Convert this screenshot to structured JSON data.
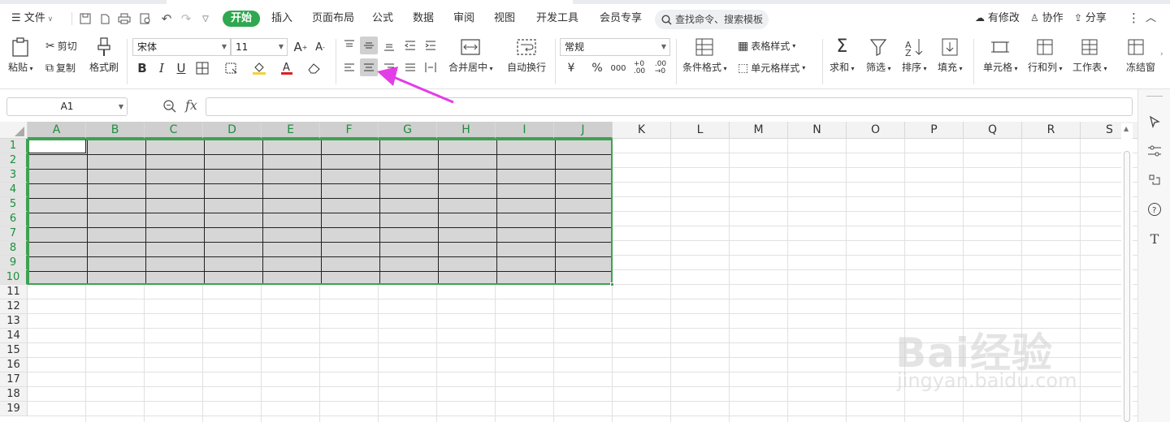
{
  "menubar": {
    "file": "文件",
    "tabs": [
      {
        "label": "开始",
        "active": true
      },
      {
        "label": "插入"
      },
      {
        "label": "页面布局"
      },
      {
        "label": "公式"
      },
      {
        "label": "数据"
      },
      {
        "label": "审阅"
      },
      {
        "label": "视图"
      },
      {
        "label": "开发工具"
      },
      {
        "label": "会员专享"
      }
    ],
    "search_placeholder": "查找命令、搜索模板",
    "right": {
      "modified": "有修改",
      "collab": "协作",
      "share": "分享"
    }
  },
  "ribbon": {
    "paste": "粘贴",
    "cut": "剪切",
    "copy": "复制",
    "format_painter": "格式刷",
    "font_name": "宋体",
    "font_size": "11",
    "merge_center": "合并居中",
    "wrap_text": "自动换行",
    "number_format": "常规",
    "cond_format": "条件格式",
    "table_style": "表格样式",
    "cell_style": "单元格样式",
    "sum": "求和",
    "filter": "筛选",
    "sort": "排序",
    "fill": "填充",
    "cell": "单元格",
    "row_col": "行和列",
    "worksheet": "工作表",
    "freeze": "冻结窗"
  },
  "formula_bar": {
    "name_box": "A1",
    "fx": "fx",
    "value": ""
  },
  "sheet": {
    "columns": [
      "A",
      "B",
      "C",
      "D",
      "E",
      "F",
      "G",
      "H",
      "I",
      "J",
      "K",
      "L",
      "M",
      "N",
      "O",
      "P",
      "Q",
      "R",
      "S"
    ],
    "selected_columns": [
      "A",
      "B",
      "C",
      "D",
      "E",
      "F",
      "G",
      "H",
      "I",
      "J"
    ],
    "rows": [
      "1",
      "2",
      "3",
      "4",
      "5",
      "6",
      "7",
      "8",
      "9",
      "10",
      "11",
      "12",
      "13",
      "14",
      "15",
      "16",
      "17",
      "18",
      "19"
    ],
    "selected_rows": 10,
    "active_cell": "A1",
    "selection_range": "A1:J10"
  },
  "colors": {
    "accent": "#2fa84f",
    "selection_border": "#3fa152",
    "arrow": "#e23de6",
    "selection_fill": "#d6d6d6"
  },
  "watermark": {
    "brand": "Bai经验",
    "domain": "jingyan.baidu.com"
  }
}
